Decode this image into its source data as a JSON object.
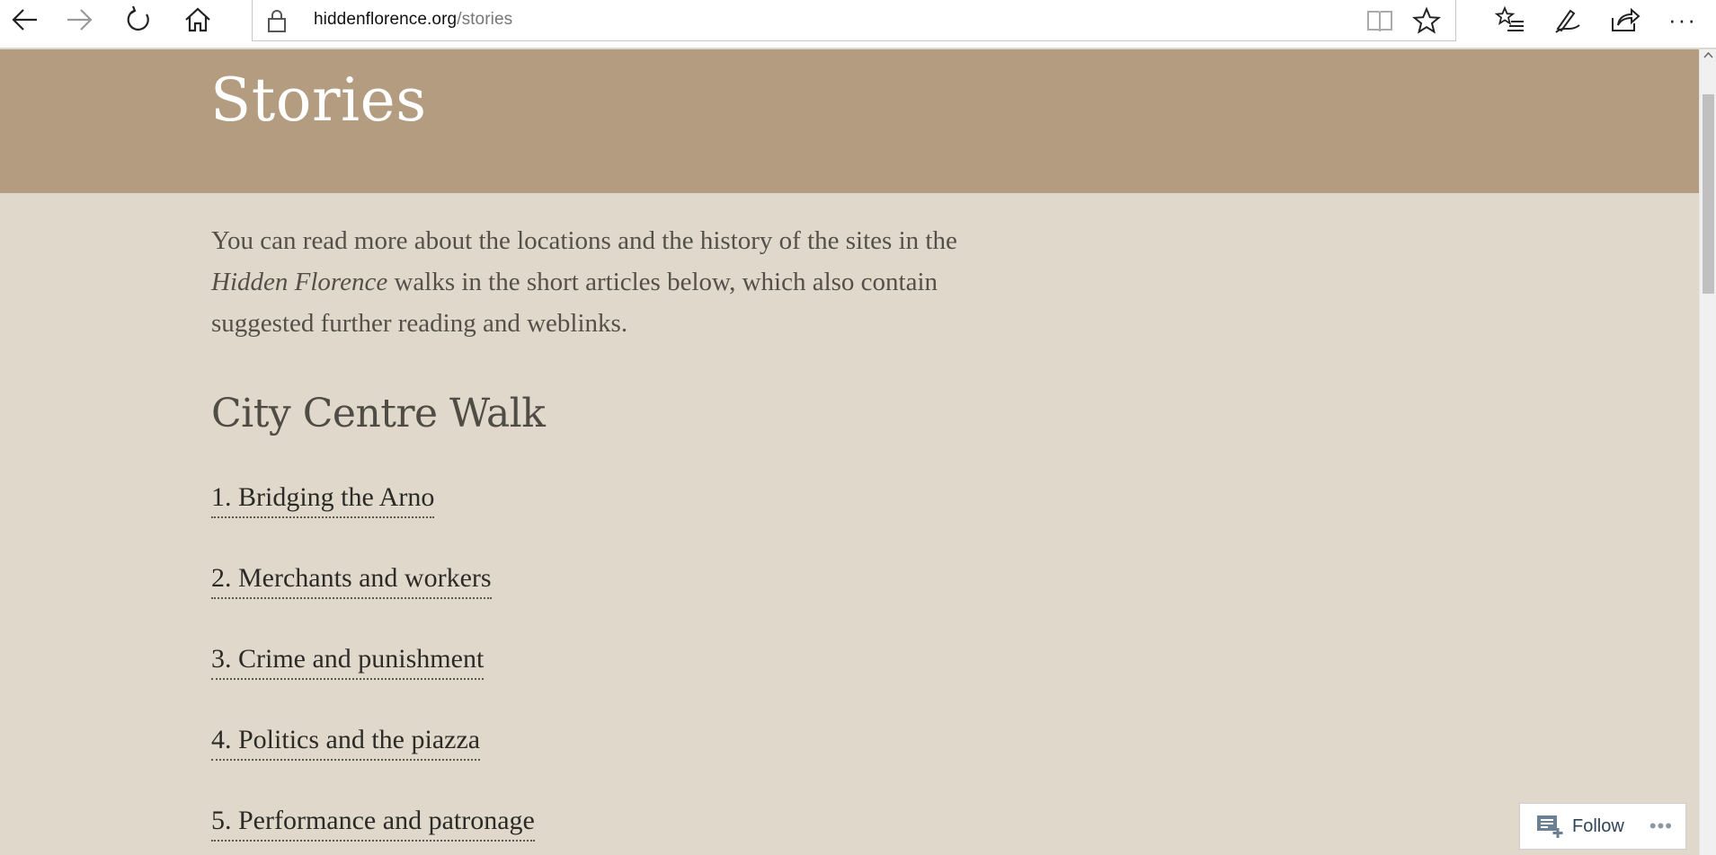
{
  "browser": {
    "url_domain": "hiddenflorence.org",
    "url_path": "/stories",
    "more_label": "···"
  },
  "page": {
    "title": "Stories",
    "intro_before": "You can read more about the locations and the history of the sites in the ",
    "intro_italic": "Hidden Florence",
    "intro_after": " walks in the short articles below, which also contain suggested further reading and weblinks.",
    "section_title": "City Centre Walk",
    "stories": [
      "1. Bridging the Arno",
      "2. Merchants and workers",
      "3. Crime and punishment",
      "4. Politics and the piazza",
      "5. Performance and patronage"
    ]
  },
  "follow_widget": {
    "label": "Follow",
    "more": "•••"
  },
  "colors": {
    "hero_band": "#b39c7f",
    "page_background": "#e0d9cb",
    "link_text": "#2b2a27"
  }
}
